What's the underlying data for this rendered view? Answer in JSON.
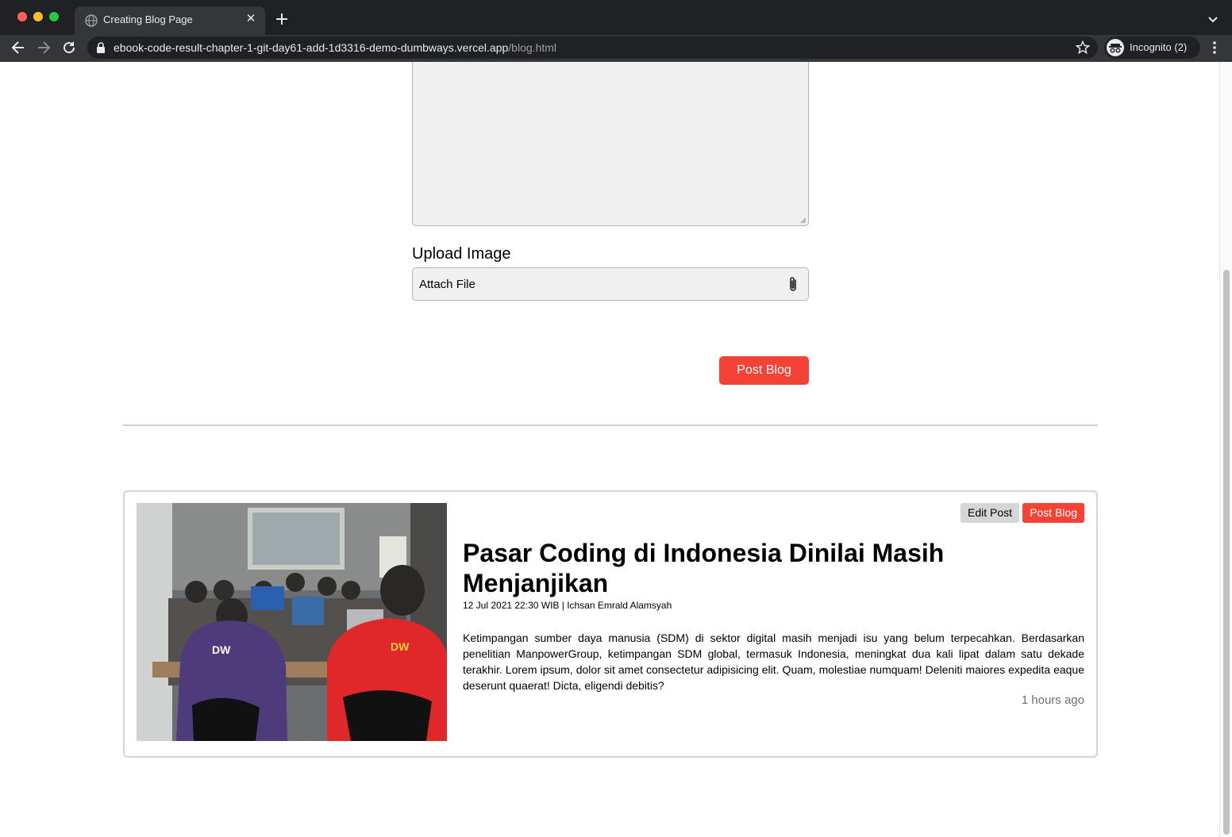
{
  "browser": {
    "tab_title": "Creating Blog Page",
    "url_host": "ebook-code-result-chapter-1-git-day61-add-1d3316-demo-dumbways.vercel.app",
    "url_path": "/blog.html",
    "profile_label": "Incognito (2)"
  },
  "form": {
    "upload_label": "Upload Image",
    "attach_placeholder": "Attach File",
    "submit_label": "Post Blog"
  },
  "blog_post": {
    "edit_label": "Edit Post",
    "post_label": "Post Blog",
    "title": "Pasar Coding di Indonesia Dinilai Masih Menjanjikan",
    "meta": "12 Jul 2021 22:30 WIB | Ichsan Emrald Alamsyah",
    "body": "Ketimpangan sumber daya manusia (SDM) di sektor digital masih menjadi isu yang belum terpecahkan. Berdasarkan penelitian ManpowerGroup, ketimpangan SDM global, termasuk Indonesia, meningkat dua kali lipat dalam satu dekade terakhir. Lorem ipsum, dolor sit amet consectetur adipisicing elit. Quam, molestiae numquam! Deleniti maiores expedita eaque deserunt quaerat! Dicta, eligendi debitis?",
    "time_ago": "1 hours ago"
  },
  "icons": {
    "tab_favicon": "globe-icon",
    "close": "close-icon",
    "new_tab": "plus-icon",
    "back": "arrow-left-icon",
    "forward": "arrow-right-icon",
    "reload": "reload-icon",
    "lock": "lock-icon",
    "bookmark": "star-icon",
    "incognito": "incognito-icon",
    "menu": "kebab-menu-icon",
    "attach": "paperclip-icon"
  },
  "colors": {
    "accent": "#f44336",
    "chrome_dark": "#202124",
    "chrome_toolbar": "#35363a",
    "input_bg": "#f0f0f0"
  }
}
